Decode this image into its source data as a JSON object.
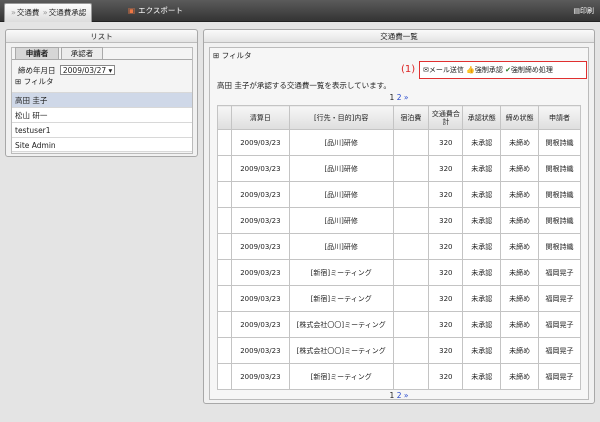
{
  "topbar": {
    "tab1_prefix": "交通費",
    "tab1_label": "交通費承認",
    "tab2_label": "エクスポート",
    "print_label": "印刷"
  },
  "left_panel": {
    "title": "リスト",
    "tabs": [
      "申請者",
      "承認者"
    ],
    "date_label": "締め年月日",
    "date_value": "2009/03/27",
    "filter_label": "フィルタ",
    "users": [
      "高田 圭子",
      "松山 研一",
      "testuser1",
      "Site Admin"
    ],
    "selected_user_index": 0
  },
  "right_panel": {
    "title": "交通費一覧",
    "filter_label": "フィルタ",
    "annotation": "(1)",
    "buttons": {
      "mail": "メール送信",
      "force_approve": "強制承認",
      "force_close": "強制締め処理"
    },
    "description": "高田 圭子が承認する交通費一覧を表示しています。",
    "pagination": {
      "pages": [
        "1",
        "2"
      ],
      "next": "»"
    },
    "columns": [
      "",
      "清算日",
      "[行先・目的]内容",
      "宿泊費",
      "交通費合計",
      "承認状態",
      "締め状態",
      "申請者"
    ],
    "rows": [
      {
        "date": "2009/03/23",
        "content": "[品川]研修",
        "lodging": "",
        "total": "320",
        "approval": "未承認",
        "closing": "未締め",
        "applicant": "関根詩織"
      },
      {
        "date": "2009/03/23",
        "content": "[品川]研修",
        "lodging": "",
        "total": "320",
        "approval": "未承認",
        "closing": "未締め",
        "applicant": "関根詩織"
      },
      {
        "date": "2009/03/23",
        "content": "[品川]研修",
        "lodging": "",
        "total": "320",
        "approval": "未承認",
        "closing": "未締め",
        "applicant": "関根詩織"
      },
      {
        "date": "2009/03/23",
        "content": "[品川]研修",
        "lodging": "",
        "total": "320",
        "approval": "未承認",
        "closing": "未締め",
        "applicant": "関根詩織"
      },
      {
        "date": "2009/03/23",
        "content": "[品川]研修",
        "lodging": "",
        "total": "320",
        "approval": "未承認",
        "closing": "未締め",
        "applicant": "関根詩織"
      },
      {
        "date": "2009/03/23",
        "content": "[新宿]ミーティング",
        "lodging": "",
        "total": "320",
        "approval": "未承認",
        "closing": "未締め",
        "applicant": "福岡晃子"
      },
      {
        "date": "2009/03/23",
        "content": "[新宿]ミーティング",
        "lodging": "",
        "total": "320",
        "approval": "未承認",
        "closing": "未締め",
        "applicant": "福岡晃子"
      },
      {
        "date": "2009/03/23",
        "content": "[株式会社〇〇]ミーティング",
        "lodging": "",
        "total": "320",
        "approval": "未承認",
        "closing": "未締め",
        "applicant": "福岡晃子"
      },
      {
        "date": "2009/03/23",
        "content": "[株式会社〇〇]ミーティング",
        "lodging": "",
        "total": "320",
        "approval": "未承認",
        "closing": "未締め",
        "applicant": "福岡晃子"
      },
      {
        "date": "2009/03/23",
        "content": "[新宿]ミーティング",
        "lodging": "",
        "total": "320",
        "approval": "未承認",
        "closing": "未締め",
        "applicant": "福岡晃子"
      }
    ]
  }
}
